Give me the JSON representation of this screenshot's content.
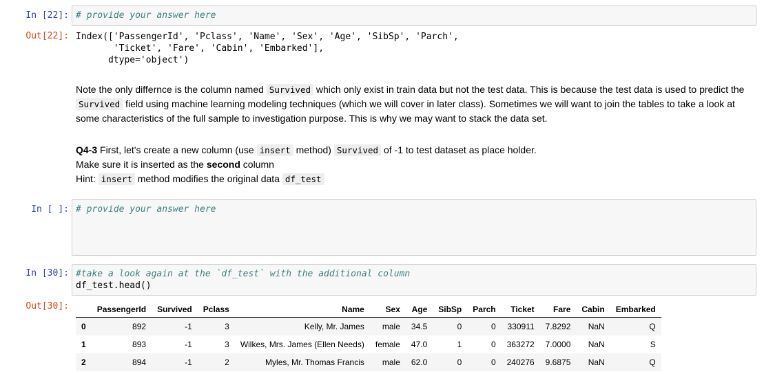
{
  "cells": {
    "cell22": {
      "in_prompt": "In [22]:",
      "code_comment": "# provide your answer here",
      "out_prompt": "Out[22]:",
      "output_lines": [
        "Index(['PassengerId', 'Pclass', 'Name', 'Sex', 'Age', 'SibSp', 'Parch',",
        "       'Ticket', 'Fare', 'Cabin', 'Embarked'],",
        "      dtype='object')"
      ]
    },
    "markdown1": {
      "t1": "Note the only differnce is the column named ",
      "c1": "Survived",
      "t2": " which only exist in train data but not the test data. This is because the test data is used to predict the ",
      "c2": "Survived",
      "t3": " field using machine learning modeling techniques (which we will cover in later class). Sometimes we will want to join the tables to take a look at some characteristics of the full sample to investigation purpose. This is why we may want to stack the data set."
    },
    "markdown2": {
      "q_label": "Q4-3",
      "t1": " First, let's create a new column (use ",
      "c1": "insert",
      "t2": " method) ",
      "c2": "Survived",
      "t3": " of -1 to test dataset as place holder.",
      "line2_a": "Make sure it is inserted as the ",
      "line2_bold": "second",
      "line2_b": " column",
      "line3_a": "Hint: ",
      "line3_c1": "insert",
      "line3_b": " method modifies the original data ",
      "line3_c2": "df_test"
    },
    "cell_empty": {
      "in_prompt": "In [ ]:",
      "code_comment": "# provide your answer here"
    },
    "cell30": {
      "in_prompt": "In [30]:",
      "code_comment": "#take a look again at the `df_test` with the additional column",
      "code_line2": "df_test.head()",
      "out_prompt": "Out[30]:",
      "table": {
        "columns": [
          "",
          "PassengerId",
          "Survived",
          "Pclass",
          "Name",
          "Sex",
          "Age",
          "SibSp",
          "Parch",
          "Ticket",
          "Fare",
          "Cabin",
          "Embarked"
        ],
        "rows": [
          [
            "0",
            "892",
            "-1",
            "3",
            "Kelly, Mr. James",
            "male",
            "34.5",
            "0",
            "0",
            "330911",
            "7.8292",
            "NaN",
            "Q"
          ],
          [
            "1",
            "893",
            "-1",
            "3",
            "Wilkes, Mrs. James (Ellen Needs)",
            "female",
            "47.0",
            "1",
            "0",
            "363272",
            "7.0000",
            "NaN",
            "S"
          ],
          [
            "2",
            "894",
            "-1",
            "2",
            "Myles, Mr. Thomas Francis",
            "male",
            "62.0",
            "0",
            "0",
            "240276",
            "9.6875",
            "NaN",
            "Q"
          ]
        ]
      }
    }
  }
}
